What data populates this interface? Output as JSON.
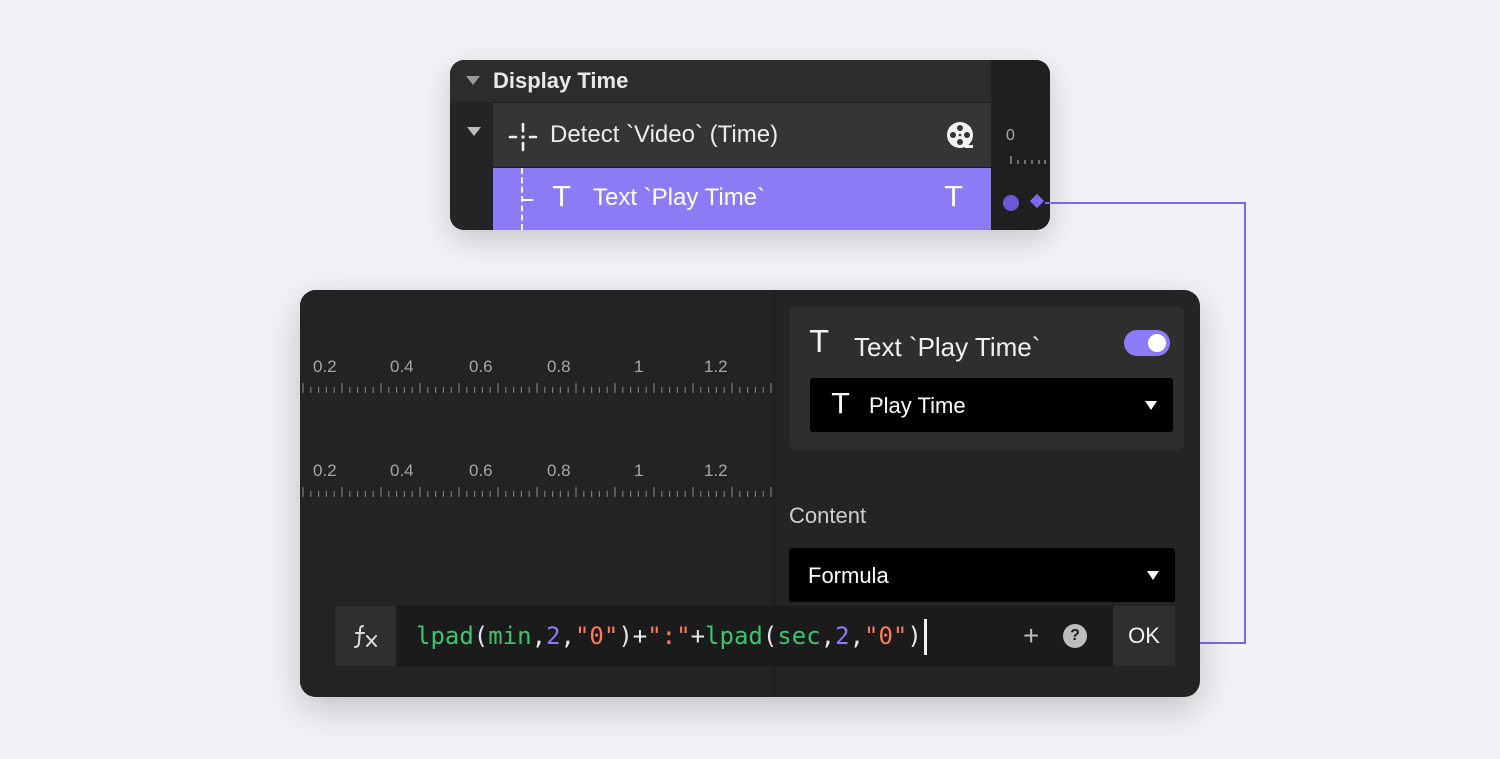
{
  "colors": {
    "page_background": "#f1f2f6",
    "panel_background": "#242424",
    "accent": "#8b7cf5",
    "keyframe_dot": "#6a58d6",
    "formula_function": "#3ec46d",
    "formula_string": "#ff7a59",
    "formula_number": "#8b7cf5",
    "formula_operator": "#e8e8e8"
  },
  "layer_panel": {
    "group": {
      "title": "Display Time",
      "icon": "caret-down-icon"
    },
    "detect_row": {
      "label": "Detect `Video` (Time)",
      "icon": "detect-crosshair-icon",
      "right_icon": "video-reel-icon"
    },
    "text_row": {
      "label": "Text `Play Time`",
      "icon": "text-t-icon",
      "right_icon": "text-t-icon",
      "selected": true
    },
    "ruler_zero": "0"
  },
  "timeline": {
    "rulers": [
      {
        "labels": [
          "0.2",
          "0.4",
          "0.6",
          "0.8",
          "1",
          "1.2"
        ]
      },
      {
        "labels": [
          "0.2",
          "0.4",
          "0.6",
          "0.8",
          "1",
          "1.2"
        ]
      }
    ]
  },
  "properties": {
    "title": "Text `Play Time`",
    "enabled": true,
    "layer_select": {
      "value": "Play Time",
      "icon": "text-t-icon"
    },
    "content_label": "Content",
    "content_select": {
      "value": "Formula"
    }
  },
  "formula_bar": {
    "fx_icon": "function-fx-icon",
    "tokens": [
      {
        "text": "lpad",
        "kind": "function"
      },
      {
        "text": "(",
        "kind": "operator"
      },
      {
        "text": "min",
        "kind": "function"
      },
      {
        "text": ",",
        "kind": "operator"
      },
      {
        "text": "2",
        "kind": "number"
      },
      {
        "text": ",",
        "kind": "operator"
      },
      {
        "text": "\"0\"",
        "kind": "string"
      },
      {
        "text": ")+",
        "kind": "operator"
      },
      {
        "text": "\":\"",
        "kind": "string"
      },
      {
        "text": "+",
        "kind": "operator"
      },
      {
        "text": "lpad",
        "kind": "function"
      },
      {
        "text": "(",
        "kind": "operator"
      },
      {
        "text": "sec",
        "kind": "function"
      },
      {
        "text": ",",
        "kind": "operator"
      },
      {
        "text": "2",
        "kind": "number"
      },
      {
        "text": ",",
        "kind": "operator"
      },
      {
        "text": "\"0\"",
        "kind": "string"
      },
      {
        "text": ")",
        "kind": "operator"
      }
    ],
    "plus_label": "+",
    "help_label": "?",
    "ok_label": "OK"
  }
}
